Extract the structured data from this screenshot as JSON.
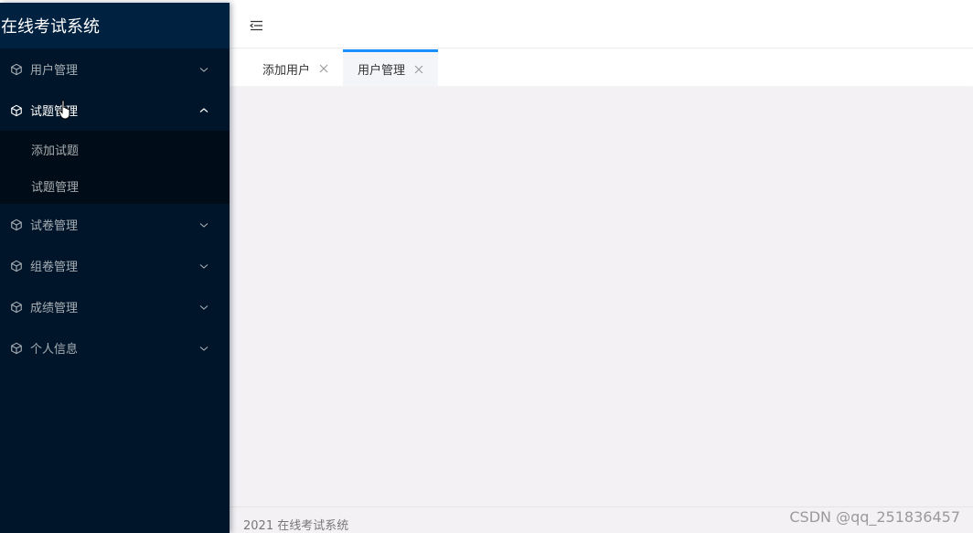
{
  "app": {
    "title": "在线考试系统"
  },
  "menu": [
    {
      "label": "用户管理",
      "icon": "cube-icon",
      "expanded": false
    },
    {
      "label": "试题管理",
      "icon": "cube-icon",
      "expanded": true,
      "children": [
        {
          "label": "添加试题"
        },
        {
          "label": "试题管理"
        }
      ]
    },
    {
      "label": "试卷管理",
      "icon": "cube-icon",
      "expanded": false
    },
    {
      "label": "组卷管理",
      "icon": "cube-icon",
      "expanded": false
    },
    {
      "label": "成绩管理",
      "icon": "cube-icon",
      "expanded": false
    },
    {
      "label": "个人信息",
      "icon": "cube-icon",
      "expanded": false
    }
  ],
  "header": {
    "fold_icon": "menu-fold-icon"
  },
  "tabs": [
    {
      "label": "添加用户",
      "active": false
    },
    {
      "label": "用户管理",
      "active": true
    }
  ],
  "footer": {
    "text": "2021 在线考试系统"
  },
  "watermark": "CSDN @qq_251836457",
  "colors": {
    "sidebar": "#001529",
    "logo_bg": "#002140",
    "submenu": "#000c17",
    "accent": "#1890ff",
    "content_bg": "#f4f1f5"
  }
}
